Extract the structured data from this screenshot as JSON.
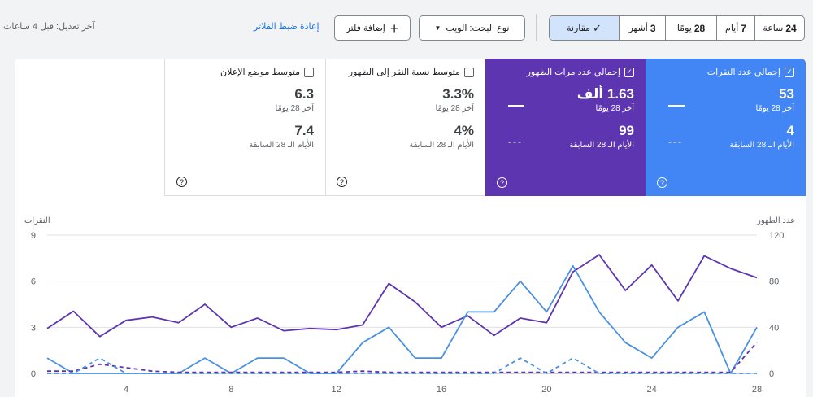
{
  "toolbar": {
    "updated": "آخر تعديل: قبل 4 ساعات",
    "reset_filters": "إعادة ضبط الفلاتر",
    "add_filter": "إضافة فلتر",
    "search_type": "نوع البحث: الويب",
    "ranges": [
      {
        "num": "24",
        "unit": "ساعة"
      },
      {
        "num": "7",
        "unit": "أيام"
      },
      {
        "num": "28",
        "unit": "يومًا"
      },
      {
        "num": "3",
        "unit": "أشهر"
      }
    ],
    "compare": "مقارنة"
  },
  "metrics": [
    {
      "label": "إجمالي عدد النقرات",
      "value": "53",
      "period": "آخر 28 يومًا",
      "prev_value": "4",
      "prev_period": "الأيام الـ 28 السابقة",
      "color": "#4285f4",
      "selected": true
    },
    {
      "label": "إجمالي عدد مرات الظهور",
      "value": "1.63 ألف",
      "period": "آخر 28 يومًا",
      "prev_value": "99",
      "prev_period": "الأيام الـ 28 السابقة",
      "color": "#5e35b1",
      "selected": true
    },
    {
      "label": "متوسط نسبة النقر إلى الظهور",
      "value": "3.3%",
      "period": "آخر 28 يومًا",
      "prev_value": "4%",
      "prev_period": "الأيام الـ 28 السابقة",
      "selected": false
    },
    {
      "label": "متوسط موضع الإعلان",
      "value": "6.3",
      "period": "آخر 28 يومًا",
      "prev_value": "7.4",
      "prev_period": "الأيام الـ 28 السابقة",
      "selected": false
    }
  ],
  "chart_data": {
    "type": "line",
    "x": [
      1,
      2,
      3,
      4,
      5,
      6,
      7,
      8,
      9,
      10,
      11,
      12,
      13,
      14,
      15,
      16,
      17,
      18,
      19,
      20,
      21,
      22,
      23,
      24,
      25,
      26,
      27,
      28
    ],
    "x_ticks": [
      "4",
      "8",
      "12",
      "16",
      "20",
      "24",
      "28"
    ],
    "left_axis": {
      "title": "النقرات",
      "ticks": [
        "0",
        "3",
        "6",
        "9"
      ],
      "ylim": [
        0,
        9
      ]
    },
    "right_axis": {
      "title": "عدد الظهور",
      "ticks": [
        "0",
        "40",
        "80",
        "120"
      ],
      "ylim": [
        0,
        120
      ]
    },
    "series": [
      {
        "axis": "right",
        "color": "#5e35b1",
        "style": "solid",
        "values": [
          39,
          54,
          32,
          46,
          49,
          44,
          60,
          40,
          48,
          37,
          39,
          38,
          42,
          78,
          62,
          40,
          50,
          33,
          48,
          44,
          88,
          103,
          72,
          94,
          63,
          102,
          91,
          83
        ]
      },
      {
        "axis": "left",
        "color": "#4a90e2",
        "style": "solid",
        "values": [
          1,
          0,
          0,
          0,
          0,
          0,
          1,
          0,
          1,
          1,
          0,
          0,
          2,
          3,
          1,
          1,
          4,
          4,
          6,
          4,
          7,
          4,
          2,
          1,
          3,
          4,
          0,
          3
        ]
      },
      {
        "axis": "right",
        "color": "#5e35b1",
        "style": "dashed",
        "values": [
          2,
          2,
          8,
          5,
          2,
          1,
          1,
          1,
          1,
          1,
          1,
          1,
          2,
          1,
          1,
          1,
          1,
          1,
          1,
          1,
          1,
          1,
          1,
          1,
          1,
          1,
          1,
          27
        ]
      },
      {
        "axis": "left",
        "color": "#4a90e2",
        "style": "dashed",
        "values": [
          0,
          0,
          1,
          0,
          0,
          0,
          0,
          0,
          0,
          0,
          0,
          0,
          0,
          0,
          0,
          0,
          0,
          0,
          1,
          0,
          1,
          0,
          0,
          0,
          0,
          0,
          0,
          0
        ]
      }
    ]
  }
}
